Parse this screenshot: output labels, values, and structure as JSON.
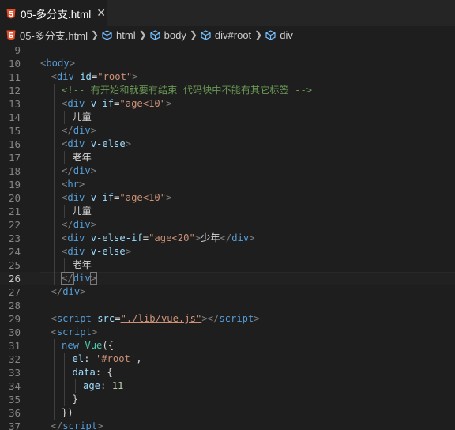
{
  "tab": {
    "label": "05-多分支.html",
    "close": "✕",
    "icon": "html5-icon"
  },
  "breadcrumb": {
    "file": "05-多分支.html",
    "items": [
      "html",
      "body",
      "div#root",
      "div"
    ]
  },
  "colors": {
    "tag": "#569cd6",
    "attr": "#9cdcfe",
    "string": "#ce9178",
    "comment": "#6a9955",
    "text": "#d4d4d4"
  },
  "editor": {
    "active_line": "26",
    "lines": [
      {
        "n": "9",
        "indent": 0,
        "tokens": []
      },
      {
        "n": "10",
        "indent": 0,
        "tokens": [
          [
            "br",
            "<"
          ],
          [
            "tag",
            "body"
          ],
          [
            "br",
            ">"
          ]
        ]
      },
      {
        "n": "11",
        "indent": 1,
        "tokens": [
          [
            "br",
            "<"
          ],
          [
            "tag",
            "div"
          ],
          [
            "txt",
            " "
          ],
          [
            "attr",
            "id"
          ],
          [
            "txt",
            "="
          ],
          [
            "str",
            "\"root\""
          ],
          [
            "br",
            ">"
          ]
        ]
      },
      {
        "n": "12",
        "indent": 2,
        "tokens": [
          [
            "cmt",
            "<!-- 有开始和就要有结束 代码块中不能有其它标签 -->"
          ]
        ]
      },
      {
        "n": "13",
        "indent": 2,
        "tokens": [
          [
            "br",
            "<"
          ],
          [
            "tag",
            "div"
          ],
          [
            "txt",
            " "
          ],
          [
            "attr",
            "v-if"
          ],
          [
            "txt",
            "="
          ],
          [
            "str",
            "\"age<10\""
          ],
          [
            "br",
            ">"
          ]
        ]
      },
      {
        "n": "14",
        "indent": 3,
        "tokens": [
          [
            "txt",
            "儿童"
          ]
        ]
      },
      {
        "n": "15",
        "indent": 2,
        "tokens": [
          [
            "br",
            "</"
          ],
          [
            "tag",
            "div"
          ],
          [
            "br",
            ">"
          ]
        ]
      },
      {
        "n": "16",
        "indent": 2,
        "tokens": [
          [
            "br",
            "<"
          ],
          [
            "tag",
            "div"
          ],
          [
            "txt",
            " "
          ],
          [
            "attr",
            "v-else"
          ],
          [
            "br",
            ">"
          ]
        ]
      },
      {
        "n": "17",
        "indent": 3,
        "tokens": [
          [
            "txt",
            "老年"
          ]
        ]
      },
      {
        "n": "18",
        "indent": 2,
        "tokens": [
          [
            "br",
            "</"
          ],
          [
            "tag",
            "div"
          ],
          [
            "br",
            ">"
          ]
        ]
      },
      {
        "n": "19",
        "indent": 2,
        "tokens": [
          [
            "br",
            "<"
          ],
          [
            "tag",
            "hr"
          ],
          [
            "br",
            ">"
          ]
        ]
      },
      {
        "n": "20",
        "indent": 2,
        "tokens": [
          [
            "br",
            "<"
          ],
          [
            "tag",
            "div"
          ],
          [
            "txt",
            " "
          ],
          [
            "attr",
            "v-if"
          ],
          [
            "txt",
            "="
          ],
          [
            "str",
            "\"age<10\""
          ],
          [
            "br",
            ">"
          ]
        ]
      },
      {
        "n": "21",
        "indent": 3,
        "tokens": [
          [
            "txt",
            "儿童"
          ]
        ]
      },
      {
        "n": "22",
        "indent": 2,
        "tokens": [
          [
            "br",
            "</"
          ],
          [
            "tag",
            "div"
          ],
          [
            "br",
            ">"
          ]
        ]
      },
      {
        "n": "23",
        "indent": 2,
        "tokens": [
          [
            "br",
            "<"
          ],
          [
            "tag",
            "div"
          ],
          [
            "txt",
            " "
          ],
          [
            "attr",
            "v-else-if"
          ],
          [
            "txt",
            "="
          ],
          [
            "str",
            "\"age<20\""
          ],
          [
            "br",
            ">"
          ],
          [
            "txt",
            "少年"
          ],
          [
            "br",
            "</"
          ],
          [
            "tag",
            "div"
          ],
          [
            "br",
            ">"
          ]
        ]
      },
      {
        "n": "24",
        "indent": 2,
        "tokens": [
          [
            "br",
            "<"
          ],
          [
            "tag",
            "div"
          ],
          [
            "txt",
            " "
          ],
          [
            "attr",
            "v-else"
          ],
          [
            "br",
            ">"
          ]
        ]
      },
      {
        "n": "25",
        "indent": 3,
        "tokens": [
          [
            "txt",
            "老年"
          ]
        ]
      },
      {
        "n": "26",
        "indent": 2,
        "tokens": [
          [
            "brm",
            "</"
          ],
          [
            "tag",
            "div"
          ],
          [
            "brm",
            ">"
          ]
        ]
      },
      {
        "n": "27",
        "indent": 1,
        "tokens": [
          [
            "br",
            "</"
          ],
          [
            "tag",
            "div"
          ],
          [
            "br",
            ">"
          ]
        ]
      },
      {
        "n": "28",
        "indent": 0,
        "tokens": []
      },
      {
        "n": "29",
        "indent": 1,
        "tokens": [
          [
            "br",
            "<"
          ],
          [
            "tag",
            "script"
          ],
          [
            "txt",
            " "
          ],
          [
            "attr",
            "src"
          ],
          [
            "txt",
            "="
          ],
          [
            "stru",
            "\"./lib/vue.js\""
          ],
          [
            "br",
            "></"
          ],
          [
            "tag",
            "script"
          ],
          [
            "br",
            ">"
          ]
        ]
      },
      {
        "n": "30",
        "indent": 1,
        "tokens": [
          [
            "br",
            "<"
          ],
          [
            "tag",
            "script"
          ],
          [
            "br",
            ">"
          ]
        ]
      },
      {
        "n": "31",
        "indent": 2,
        "tokens": [
          [
            "kw",
            "new"
          ],
          [
            "txt",
            " "
          ],
          [
            "cls",
            "Vue"
          ],
          [
            "txt",
            "({"
          ]
        ]
      },
      {
        "n": "32",
        "indent": 3,
        "tokens": [
          [
            "attr",
            "el"
          ],
          [
            "txt",
            ": "
          ],
          [
            "str",
            "'#root'"
          ],
          [
            "txt",
            ","
          ]
        ]
      },
      {
        "n": "33",
        "indent": 3,
        "tokens": [
          [
            "attr",
            "data"
          ],
          [
            "txt",
            ": {"
          ]
        ]
      },
      {
        "n": "34",
        "indent": 4,
        "tokens": [
          [
            "attr",
            "age"
          ],
          [
            "txt",
            ": "
          ],
          [
            "num",
            "11"
          ]
        ]
      },
      {
        "n": "35",
        "indent": 3,
        "tokens": [
          [
            "txt",
            "}"
          ]
        ]
      },
      {
        "n": "36",
        "indent": 2,
        "tokens": [
          [
            "txt",
            "})"
          ]
        ]
      },
      {
        "n": "37",
        "indent": 1,
        "tokens": [
          [
            "br",
            "</"
          ],
          [
            "tag",
            "script"
          ],
          [
            "br",
            ">"
          ]
        ]
      }
    ]
  }
}
